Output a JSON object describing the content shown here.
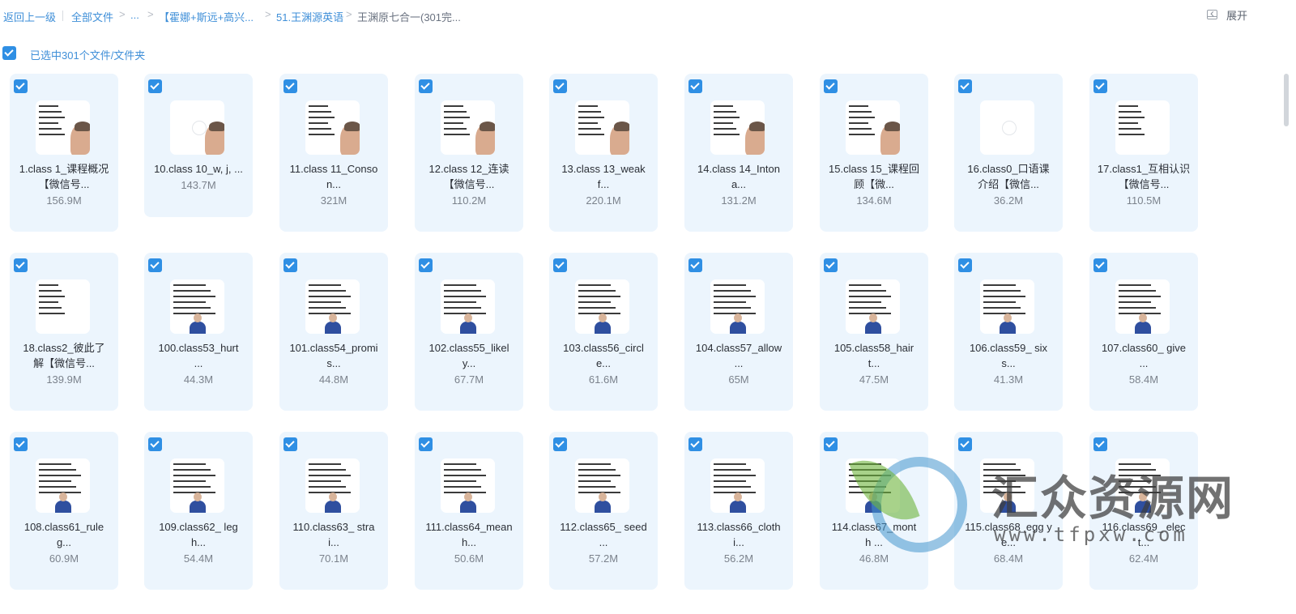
{
  "breadcrumb": {
    "back": "返回上一级",
    "all_files": "全部文件",
    "ellipsis": "...",
    "folder1": "【霍娜+斯远+高兴...",
    "folder2": "51.王渊源英语",
    "current": "王渊原七合一(301完..."
  },
  "toolbar": {
    "expand_label": "展开",
    "chevron_icon": "chevron-left-icon",
    "panel_icon": "panel-icon"
  },
  "selection": {
    "text": "已选中301个文件/文件夹",
    "checked": true
  },
  "files": [
    {
      "name1": "1.class 1_课程概况",
      "name2": "【微信号...",
      "size": "156.9M",
      "thumb": "slide-face"
    },
    {
      "name1": "10.class 10_w, j, ...",
      "name2": "",
      "size": "143.7M",
      "thumb": "blank-face"
    },
    {
      "name1": "11.class 11_Conso",
      "name2": "n...",
      "size": "321M",
      "thumb": "slide-face"
    },
    {
      "name1": "12.class 12_连读",
      "name2": "【微信号...",
      "size": "110.2M",
      "thumb": "slide-face"
    },
    {
      "name1": "13.class 13_weak",
      "name2": "f...",
      "size": "220.1M",
      "thumb": "slide-face"
    },
    {
      "name1": "14.class 14_Inton",
      "name2": "a...",
      "size": "131.2M",
      "thumb": "slide-face"
    },
    {
      "name1": "15.class 15_课程回",
      "name2": "顾【微...",
      "size": "134.6M",
      "thumb": "slide-face"
    },
    {
      "name1": "16.class0_口语课",
      "name2": "介绍【微信...",
      "size": "36.2M",
      "thumb": "blank"
    },
    {
      "name1": "17.class1_互相认识",
      "name2": "【微信号...",
      "size": "110.5M",
      "thumb": "slide"
    },
    {
      "name1": "18.class2_彼此了",
      "name2": "解【微信号...",
      "size": "139.9M",
      "thumb": "slide"
    },
    {
      "name1": "100.class53_hurt",
      "name2": "...",
      "size": "44.3M",
      "thumb": "slide-suit"
    },
    {
      "name1": "101.class54_promi",
      "name2": "s...",
      "size": "44.8M",
      "thumb": "slide-suit"
    },
    {
      "name1": "102.class55_likel",
      "name2": "y...",
      "size": "67.7M",
      "thumb": "slide-suit"
    },
    {
      "name1": "103.class56_circl",
      "name2": "e...",
      "size": "61.6M",
      "thumb": "slide-suit"
    },
    {
      "name1": "104.class57_allow",
      "name2": "...",
      "size": "65M",
      "thumb": "slide-suit"
    },
    {
      "name1": "105.class58_hair",
      "name2": "t...",
      "size": "47.5M",
      "thumb": "slide-suit"
    },
    {
      "name1": "106.class59_ six",
      "name2": "s...",
      "size": "41.3M",
      "thumb": "slide-suit"
    },
    {
      "name1": "107.class60_ give",
      "name2": "...",
      "size": "58.4M",
      "thumb": "slide-suit"
    },
    {
      "name1": "108.class61_rule",
      "name2": "g...",
      "size": "60.9M",
      "thumb": "slide-suit"
    },
    {
      "name1": "109.class62_ leg",
      "name2": "h...",
      "size": "54.4M",
      "thumb": "slide-suit"
    },
    {
      "name1": "110.class63_ stra",
      "name2": "i...",
      "size": "70.1M",
      "thumb": "slide-suit"
    },
    {
      "name1": "111.class64_mean",
      "name2": "h...",
      "size": "50.6M",
      "thumb": "slide-suit"
    },
    {
      "name1": "112.class65_ seed",
      "name2": "...",
      "size": "57.2M",
      "thumb": "slide-suit"
    },
    {
      "name1": "113.class66_cloth",
      "name2": "i...",
      "size": "56.2M",
      "thumb": "slide-suit"
    },
    {
      "name1": "114.class67_mont",
      "name2": "h ...",
      "size": "46.8M",
      "thumb": "slide-suit"
    },
    {
      "name1": "115.class68_egg y",
      "name2": "e...",
      "size": "68.4M",
      "thumb": "slide-suit"
    },
    {
      "name1": "116.class69_ elec",
      "name2": "t...",
      "size": "62.4M",
      "thumb": "slide-suit"
    }
  ],
  "watermark": {
    "title": "汇众资源网",
    "url": "www.tfpxw.com"
  }
}
